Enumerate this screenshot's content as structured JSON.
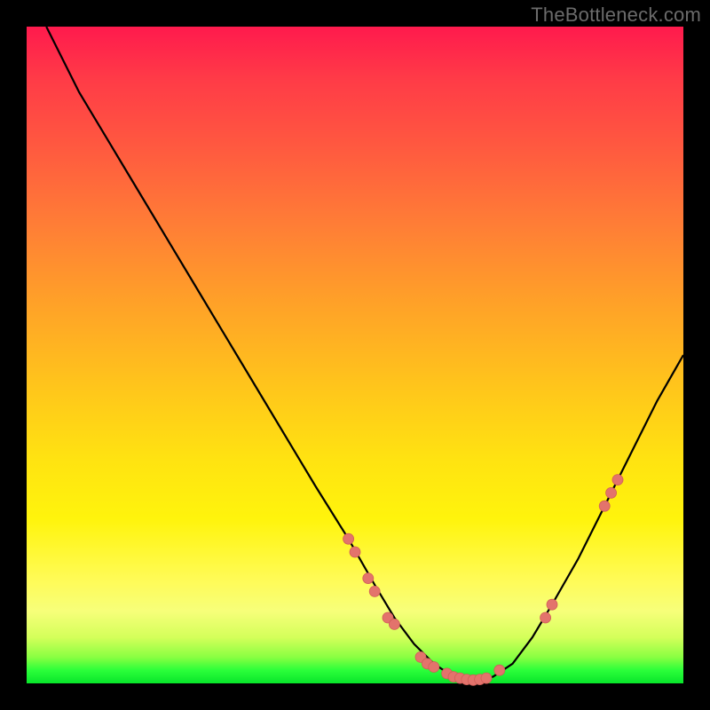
{
  "watermark": "TheBottleneck.com",
  "colors": {
    "page_bg": "#000000",
    "curve_stroke": "#000000",
    "marker_fill": "#e3736c",
    "marker_stroke": "#d05e57"
  },
  "chart_data": {
    "type": "line",
    "title": "",
    "xlabel": "",
    "ylabel": "",
    "xlim": [
      0,
      100
    ],
    "ylim": [
      0,
      100
    ],
    "grid": false,
    "legend": false,
    "curve": {
      "description": "Bottleneck curve rendered on color gradient. Values are bottleneck percent (y) vs a normalized hardware-balance axis (x). Estimated from pixel positions; no numeric axis labels are shown in the image.",
      "x": [
        3,
        8,
        14,
        20,
        26,
        32,
        38,
        44,
        49,
        53,
        56,
        59,
        62,
        65,
        68,
        71,
        74,
        77,
        80,
        84,
        88,
        92,
        96,
        100
      ],
      "y": [
        100,
        90,
        80,
        70,
        60,
        50,
        40,
        30,
        22,
        15,
        10,
        6,
        3,
        1,
        0.5,
        1,
        3,
        7,
        12,
        19,
        27,
        35,
        43,
        50
      ]
    },
    "markers": {
      "description": "Highlighted sample points (salmon dots) along the curve, clustered near the valley and on the right rising arm.",
      "points": [
        {
          "x": 49,
          "y": 22
        },
        {
          "x": 50,
          "y": 20
        },
        {
          "x": 52,
          "y": 16
        },
        {
          "x": 53,
          "y": 14
        },
        {
          "x": 55,
          "y": 10
        },
        {
          "x": 56,
          "y": 9
        },
        {
          "x": 60,
          "y": 4
        },
        {
          "x": 61,
          "y": 3
        },
        {
          "x": 62,
          "y": 2.5
        },
        {
          "x": 64,
          "y": 1.5
        },
        {
          "x": 65,
          "y": 1
        },
        {
          "x": 66,
          "y": 0.8
        },
        {
          "x": 67,
          "y": 0.6
        },
        {
          "x": 68,
          "y": 0.5
        },
        {
          "x": 69,
          "y": 0.6
        },
        {
          "x": 70,
          "y": 0.8
        },
        {
          "x": 72,
          "y": 2
        },
        {
          "x": 79,
          "y": 10
        },
        {
          "x": 80,
          "y": 12
        },
        {
          "x": 88,
          "y": 27
        },
        {
          "x": 89,
          "y": 29
        },
        {
          "x": 90,
          "y": 31
        }
      ]
    }
  }
}
